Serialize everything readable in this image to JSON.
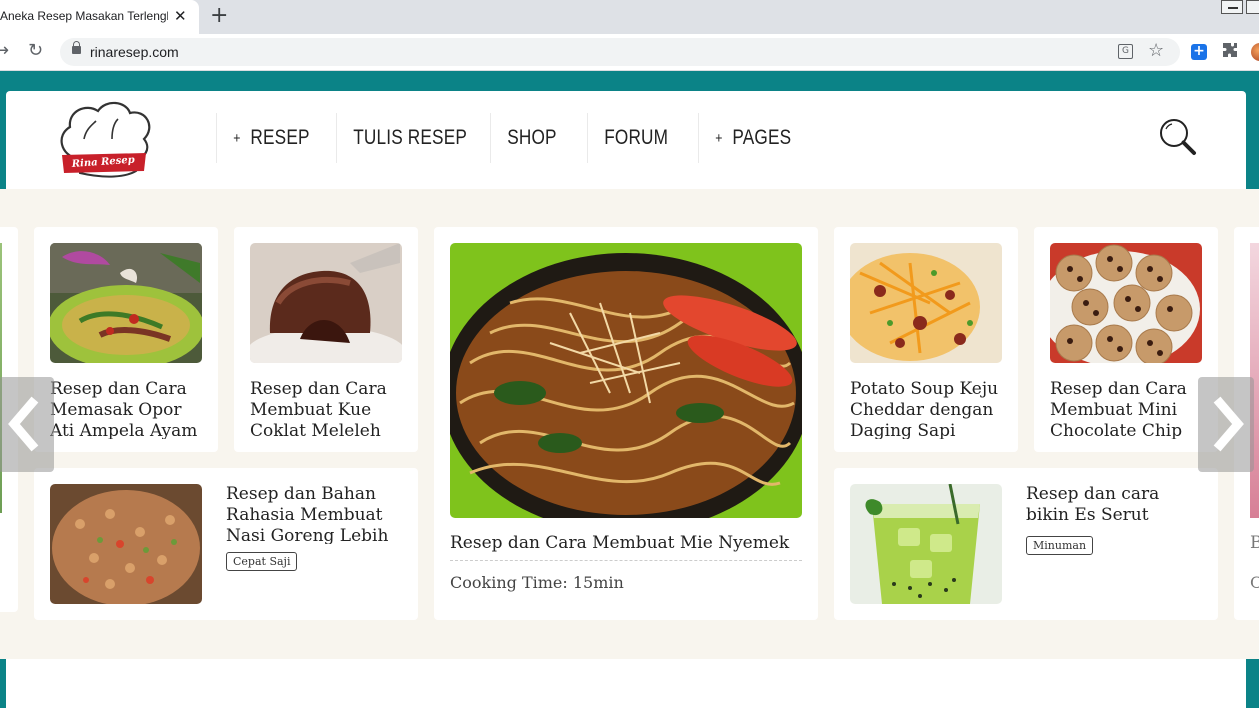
{
  "browser": {
    "tab_title": "Aneka Resep Masakan Terlengkap | Rina Resep",
    "tab_close": "✕",
    "new_tab": "+",
    "url": "rinaresep.com",
    "back": "→",
    "reload": "↻",
    "translate_glyph": "G",
    "star": "☆",
    "ext_plus": "+",
    "ext_puzzle": "✦"
  },
  "site": {
    "logo_text": "Rina Resep",
    "menu": [
      {
        "label": "RESEP",
        "plus": "+"
      },
      {
        "label": "TULIS RESEP"
      },
      {
        "label": "SHOP"
      },
      {
        "label": "FORUM"
      },
      {
        "label": "PAGES",
        "plus": "+"
      }
    ]
  },
  "recipes": {
    "opor": "Resep dan Cara Memasak Opor Ati Ampela Ayam",
    "kue": "Resep dan Cara Membuat Kue Coklat Meleleh",
    "mie": "Resep dan Cara Membuat Mie Nyemek Khas Bandung",
    "mie_cook": "Cooking Time: 15min",
    "potato": "Potato Soup Keju Cheddar dengan Daging Sapi",
    "cookie": "Resep dan Cara Membuat Mini Chocolate Chip Cookies",
    "nasi": "Resep dan Bahan Rahasia Membuat Nasi Goreng Lebih Enak",
    "nasi_tag": "Cepat Saji",
    "es": "Resep dan cara bikin Es Serut Timun",
    "es_tag": "Minuman",
    "edge_right_1": "B",
    "edge_right_2": "C"
  },
  "colors": {
    "page_bg": "#0b8387",
    "content_bg": "#f8f5ee",
    "logo_red": "#c8202a"
  }
}
